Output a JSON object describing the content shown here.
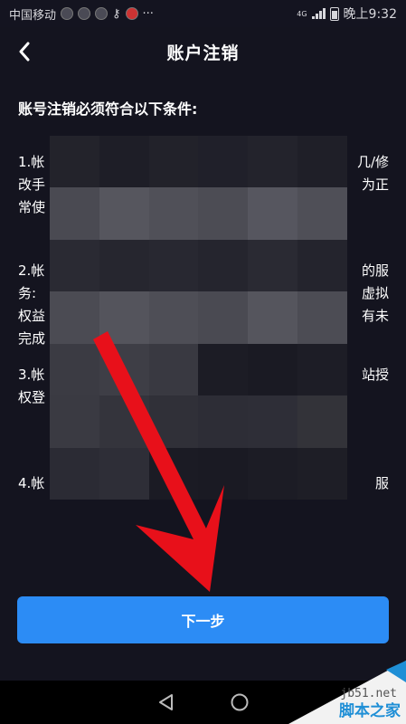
{
  "status_bar": {
    "carrier": "中国移动",
    "network": "4G",
    "time": "晚上9:32"
  },
  "header": {
    "title": "账户注销"
  },
  "content": {
    "heading": "账号注销必须符合以下条件:",
    "conditions": [
      {
        "lines": [
          {
            "lead": "1.帐",
            "trail": "几/修"
          },
          {
            "lead": "改手",
            "trail": "为正"
          },
          {
            "lead": "常使",
            "trail": ""
          }
        ]
      },
      {
        "lines": [
          {
            "lead": "2.帐",
            "trail": "的服"
          },
          {
            "lead": "务:",
            "trail": "虚拟"
          },
          {
            "lead": "权益",
            "trail": "有未"
          },
          {
            "lead": "完成",
            "trail": ""
          }
        ]
      },
      {
        "lines": [
          {
            "lead": "3.帐",
            "trail": "站授"
          },
          {
            "lead": "权登",
            "trail": ""
          }
        ]
      },
      {
        "lines": [
          {
            "lead": "4.帐",
            "trail": "服"
          }
        ]
      }
    ]
  },
  "footer": {
    "next_label": "下一步"
  },
  "watermark": {
    "site": "脚本之家",
    "url": "jb51.net"
  },
  "colors": {
    "background": "#14141f",
    "accent": "#2c8cf5",
    "arrow": "#e8101a"
  }
}
